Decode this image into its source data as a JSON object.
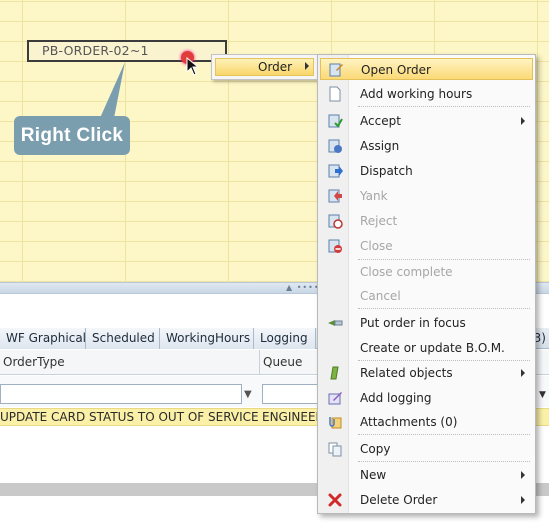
{
  "planner": {
    "order_block_label": "PB-ORDER-02~1",
    "callout_text": "Right Click"
  },
  "submenu": {
    "label": "Order"
  },
  "context_menu": {
    "items": [
      {
        "label": "Open Order",
        "icon": "open-order-icon",
        "highlighted": true,
        "enabled": true,
        "submenu": false
      },
      {
        "label": "Add working hours",
        "icon": "document-icon",
        "enabled": true,
        "submenu": false
      },
      {
        "label": "Accept",
        "icon": "accept-icon",
        "enabled": true,
        "submenu": true
      },
      {
        "label": "Assign",
        "icon": "assign-icon",
        "enabled": true,
        "submenu": false
      },
      {
        "label": "Dispatch",
        "icon": "dispatch-icon",
        "enabled": true,
        "submenu": false
      },
      {
        "label": "Yank",
        "icon": "yank-icon",
        "enabled": false,
        "submenu": false
      },
      {
        "label": "Reject",
        "icon": "reject-icon",
        "enabled": false,
        "submenu": false
      },
      {
        "label": "Close",
        "icon": "close-icon",
        "enabled": false,
        "submenu": false
      },
      {
        "label": "Close complete",
        "icon": "",
        "enabled": false,
        "submenu": false
      },
      {
        "label": "Cancel",
        "icon": "",
        "enabled": false,
        "submenu": false
      },
      {
        "label": "Put order in focus",
        "icon": "focus-icon",
        "enabled": true,
        "submenu": false
      },
      {
        "label": "Create or update B.O.M.",
        "icon": "",
        "enabled": true,
        "submenu": false
      },
      {
        "label": "Related objects",
        "icon": "related-objects-icon",
        "enabled": true,
        "submenu": true
      },
      {
        "label": "Add logging",
        "icon": "add-logging-icon",
        "enabled": true,
        "submenu": false
      },
      {
        "label": "Attachments (0)",
        "icon": "attachment-icon",
        "enabled": true,
        "submenu": false
      },
      {
        "label": "Copy",
        "icon": "copy-icon",
        "enabled": true,
        "submenu": false
      },
      {
        "label": "New",
        "icon": "",
        "enabled": true,
        "submenu": true
      },
      {
        "label": "Delete Order",
        "icon": "delete-icon",
        "enabled": true,
        "submenu": true
      }
    ]
  },
  "bottom_grid": {
    "tabs": [
      "WF Graphical",
      "Scheduled",
      "WorkingHours",
      "Logging"
    ],
    "tab_partial": "3)",
    "columns": [
      "OrderType",
      "Queue"
    ],
    "row": {
      "ordertype": "UPDATE CARD STATUS TO OUT OF SERVICE",
      "queue": "ENGINEER"
    }
  },
  "colors": {
    "planner_bg": "#fdf6c7",
    "highlight": "#fbd976",
    "callout": "#7b9eaf",
    "row_highlight": "#fbf0a8"
  }
}
